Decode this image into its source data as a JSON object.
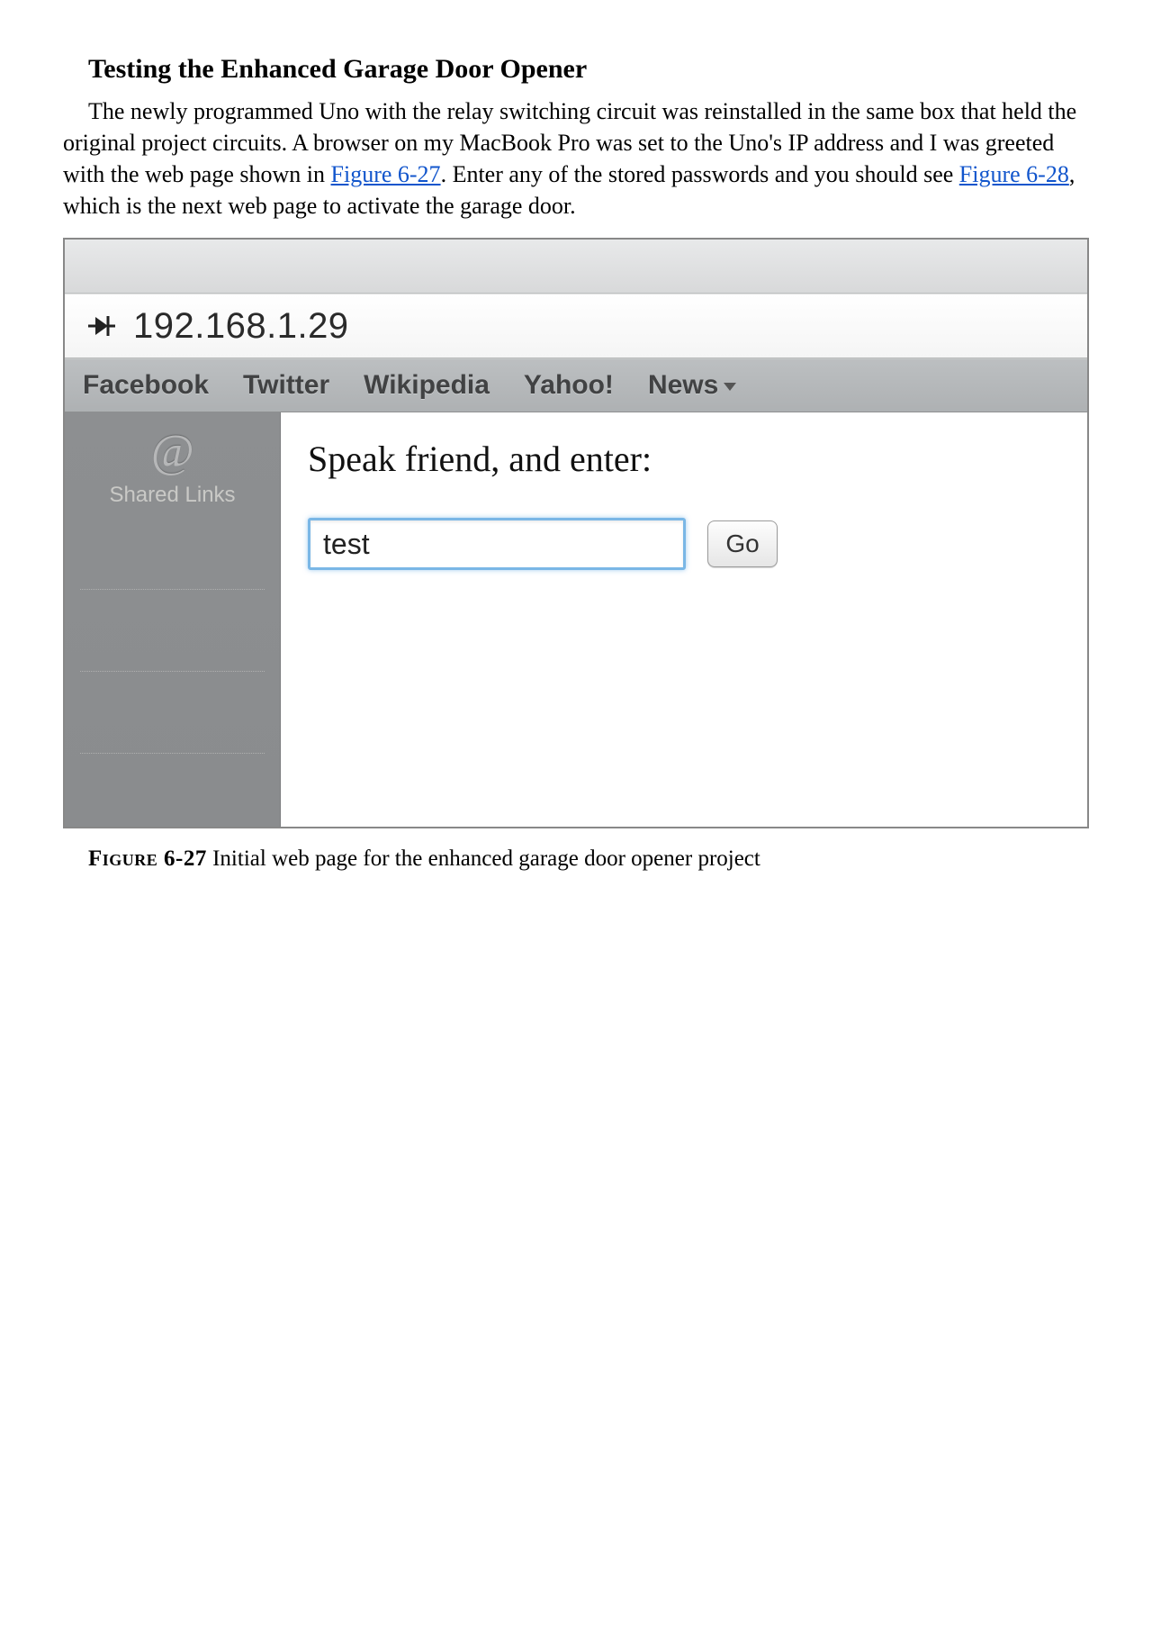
{
  "heading": "Testing the Enhanced Garage Door Opener",
  "paragraph": {
    "p1": "The newly programmed Uno with the relay switching circuit was reinstalled in the same box that held the original project circuits. A browser on my MacBook Pro was set to the Uno's IP address and I was greeted with the web page shown in ",
    "link1": "Figure 6-27",
    "p2": ". Enter any of the stored passwords and you should see ",
    "link2": "Figure 6-28",
    "p3": ", which is the next web page to activate the garage door."
  },
  "browser": {
    "url": "192.168.1.29",
    "bookmarks": [
      "Facebook",
      "Twitter",
      "Wikipedia",
      "Yahoo!",
      "News"
    ],
    "sidebar_label": "Shared Links"
  },
  "page": {
    "prompt": "Speak friend, and enter:",
    "input_value": "test",
    "button_label": "Go"
  },
  "caption": {
    "label": "Figure 6-27",
    "text": " Initial web page for the enhanced garage door opener project"
  }
}
